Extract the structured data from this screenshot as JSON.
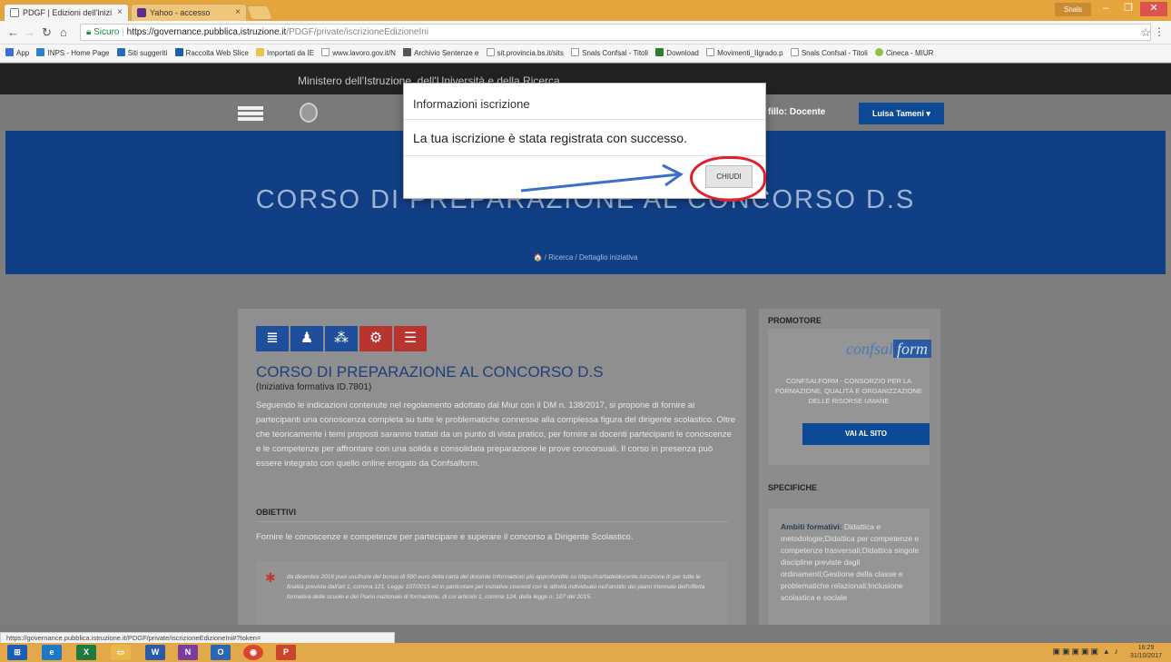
{
  "browser": {
    "tabs": [
      {
        "label": "PDGF | Edizioni dell'Inizi",
        "active": true
      },
      {
        "label": "Yahoo - accesso",
        "active": false
      }
    ],
    "profile_badge": "Snals",
    "address": {
      "secure_label": "Sicuro",
      "url_host": "https://governance.pubblica.istruzione.it",
      "url_path": "/PDGF/private/iscrizioneEdizioneIni"
    },
    "bookmarks": [
      {
        "label": "App",
        "color": "#3b6fd6"
      },
      {
        "label": "INPS - Home Page",
        "color": "#2a7fd4"
      },
      {
        "label": "Siti suggeriti",
        "color": "#2b6cb0"
      },
      {
        "label": "Raccolta Web Slice",
        "color": "#1c5fa8"
      },
      {
        "label": "Importati da IE",
        "color": "#e7c64a"
      },
      {
        "label": "www.lavoro.gov.it/N",
        "color": "#999999"
      },
      {
        "label": "Archivio Sentenze e",
        "color": "#555555"
      },
      {
        "label": "sit.provincia.bs.it/sits",
        "color": "#999999"
      },
      {
        "label": "Snals Confsal - Titoli",
        "color": "#999999"
      },
      {
        "label": "Download",
        "color": "#2e7d32"
      },
      {
        "label": "Movimenti_IIgrado.p",
        "color": "#999999"
      },
      {
        "label": "Snals Confsal - Titoli",
        "color": "#999999"
      },
      {
        "label": "Cineca - MIUR",
        "color": "#8bc34a"
      }
    ],
    "status_url": "https://governance.pubblica.istruzione.it/PDGF/private/iscrizioneEdizioneIni#?token="
  },
  "site": {
    "ministry": "Ministero dell'Istruzione, dell'Università e della Ricerca",
    "profile_label": "fillo: Docente",
    "user_button": "Luisa Tameni",
    "hero_title": "CORSO DI PREPARAZIONE AL CONCORSO D.S",
    "breadcrumb": "🏠 / Ricerca / Dettaglio iniziativa"
  },
  "course": {
    "title": "CORSO DI PREPARAZIONE AL CONCORSO D.S",
    "subtitle": "(Iniziativa formativa ID.7801)",
    "description": "Seguendo le indicazioni contenute nel regolamento adottato dal Miur con il DM n. 138/2017, si propone di fornire ai partecipanti una conoscenza completa su tutte le problematiche connesse alla complessa figura del dirigente scolastico. Oltre che teoricamente i temi proposti saranno trattati da un punto di vista pratico, per fornire ai docenti partecipanti le conoscenze e le competenze per affrontare con una solida e consolidata preparazione le prove concorsuali. Il corso in presenza può essere integrato con quello online erogato da Confsalform.",
    "objectives_heading": "OBIETTIVI",
    "objectives_text": "Fornire le conoscenze e competenze per partecipare e superare il concorso a Dirigente Scolastico.",
    "note": "da dicembre 2016 puoi usufruire del bonus di 500 euro della carta del docente Informazioni più approfondite su https://cartadeldocente.istruzione.it/ per tutte le finalità previste dall'art 1, comma 121, Legge 107/2015 ed in particolare per iniziative coerenti con le attività individuate nell'ambito del piano triennale dell'offerta formativa delle scuole e del Piano nazionale di formazione, di cui articolo 1, comma 124, della legge n. 107 del 2015."
  },
  "sidebar": {
    "promoter_heading": "PROMOTORE",
    "logo_main": "confsal",
    "logo_tail": "form",
    "promoter_name": "CONFSALFORM - CONSORZIO PER LA FORMAZIONE, QUALITÀ E ORGANIZZAZIONE DELLE RISORSE UMANE",
    "visit_button": "VAI AL SITO",
    "specs_heading": "SPECIFICHE",
    "specs_label": "Ambiti formativi:",
    "specs_text": "Didattica e metodologie;Didattica per competenze e competenze trasversali;Didattica singole discipline previste dagli ordinamenti;Gestione della classe e problematiche relazionali;Inclusione scolastica e sociale"
  },
  "modal": {
    "title": "Informazioni iscrizione",
    "message": "La tua iscrizione è stata registrata con successo.",
    "close_button": "CHIUDI"
  },
  "taskbar": {
    "time": "16:29",
    "date": "31/10/2017"
  }
}
